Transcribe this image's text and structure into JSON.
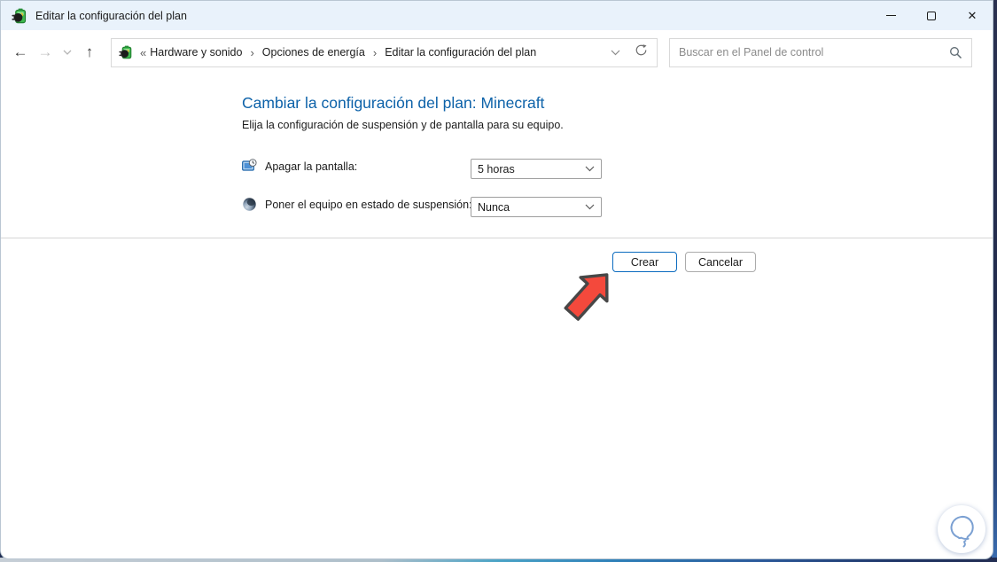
{
  "window": {
    "title": "Editar la configuración del plan",
    "controls": {
      "minimize": "minimize",
      "maximize": "maximize",
      "close": "✕"
    }
  },
  "navbar": {
    "back": "←",
    "forward": "→",
    "history_chevron": "⌄",
    "up": "↑",
    "breadcrumb": {
      "collapsed_marker": "«",
      "items": [
        "Hardware y sonido",
        "Opciones de energía",
        "Editar la configuración del plan"
      ],
      "separator": "›"
    },
    "search": {
      "placeholder": "Buscar en el Panel de control"
    }
  },
  "main": {
    "heading": "Cambiar la configuración del plan: Minecraft",
    "subheading": "Elija la configuración de suspensión y de pantalla para su equipo.",
    "settings": [
      {
        "icon": "display-clock-icon",
        "label": "Apagar la pantalla:",
        "value": "5 horas"
      },
      {
        "icon": "sleep-sphere-icon",
        "label": "Poner el equipo en estado de suspensión:",
        "value": "Nunca"
      }
    ],
    "buttons": {
      "create": "Crear",
      "cancel": "Cancelar"
    }
  },
  "icons": [
    "power-plan-icon",
    "search-icon",
    "refresh-icon",
    "chevron-down-icon",
    "red-pointer-arrow",
    "lightbulb-logo"
  ],
  "colors": {
    "titlebar_bg": "#e9f2fb",
    "heading_blue": "#0d62a9",
    "primary_button_border": "#0b6bbf",
    "arrow_red": "#f4493c",
    "divider": "#d6d6d6"
  }
}
